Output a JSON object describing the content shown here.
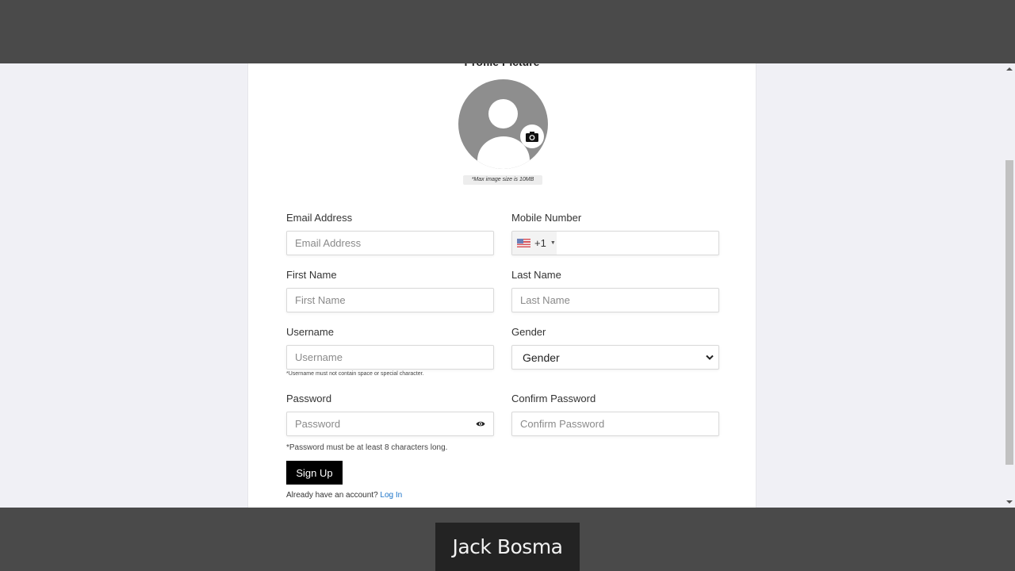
{
  "profile": {
    "title": "Profile Picture",
    "max_size_note": "*Max image size is 10MB"
  },
  "form": {
    "email": {
      "label": "Email Address",
      "placeholder": "Email Address",
      "value": ""
    },
    "mobile": {
      "label": "Mobile Number",
      "country_code": "+1",
      "country": "US",
      "value": ""
    },
    "first_name": {
      "label": "First Name",
      "placeholder": "First Name",
      "value": ""
    },
    "last_name": {
      "label": "Last Name",
      "placeholder": "Last Name",
      "value": ""
    },
    "username": {
      "label": "Username",
      "placeholder": "Username",
      "value": "",
      "hint": "*Username must not contain space or special character."
    },
    "gender": {
      "label": "Gender",
      "selected": "Gender"
    },
    "password": {
      "label": "Password",
      "placeholder": "Password",
      "value": "",
      "hint": "*Password must be at least 8 characters long."
    },
    "confirm_password": {
      "label": "Confirm Password",
      "placeholder": "Confirm Password",
      "value": ""
    },
    "submit_label": "Sign Up",
    "account_prompt": "Already have an account?",
    "login_link": "Log In"
  },
  "caption": {
    "text": "Jack Bosma"
  },
  "colors": {
    "link": "#1a73c8",
    "button_bg": "#000000",
    "page_bg": "#f0f0f5"
  }
}
